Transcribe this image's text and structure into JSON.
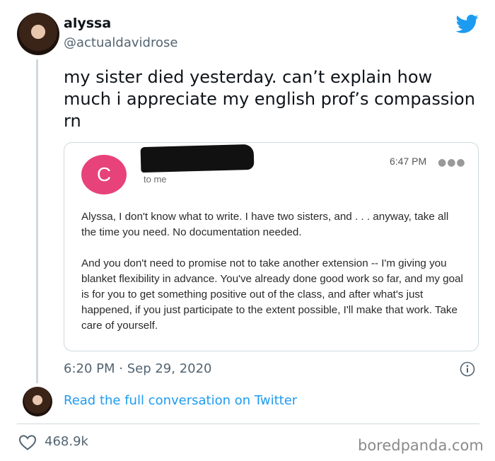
{
  "author": {
    "display_name": "alyssa",
    "handle": "@actualdavidrose"
  },
  "tweet": {
    "text": "my sister died yesterday. can’t explain how much i appreciate my english prof’s compassion rn",
    "timestamp": "6:20 PM · Sep 29, 2020"
  },
  "email": {
    "avatar_letter": "C",
    "recipient": "to me",
    "time": "6:47 PM",
    "paragraphs": [
      "Alyssa, I don't know what to write. I have two sisters, and . . . anyway, take all the time you need. No documentation needed.",
      "And you don't need to promise not to take another extension -- I'm giving you blanket flexibility in advance. You've already done good work so far, and my goal is for you to get something positive out of the class, and after what's just happened, if you just participate to the extent possible, I'll make that work. Take care of yourself."
    ],
    "avatar_color": "#e8427a"
  },
  "conversation_link": "Read the full conversation on Twitter",
  "stats": {
    "likes": "468.9k"
  },
  "watermark": "boredpanda.com",
  "colors": {
    "twitter_blue": "#1d9bf0",
    "secondary_text": "#536471"
  },
  "icons": [
    "twitter-bird-icon",
    "info-icon",
    "heart-icon"
  ]
}
